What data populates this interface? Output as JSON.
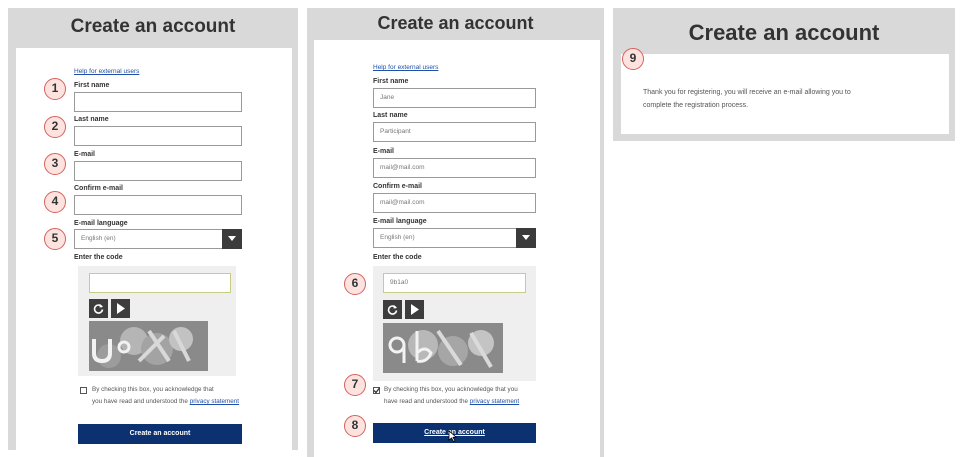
{
  "left": {
    "title": "Create an account",
    "help_link": "Help for external users",
    "first_name_label": "First name",
    "last_name_label": "Last name",
    "email_label": "E-mail",
    "confirm_email_label": "Confirm e-mail",
    "email_language_label": "E-mail language",
    "email_language_value": "English (en)",
    "code_label": "Enter the code",
    "code_value": "",
    "checkbox_text_1": "By checking this box, you acknowledge that",
    "checkbox_text_2": "you have read and understood the",
    "privacy_link": "privacy statement",
    "submit_label": "Create an account",
    "steps": [
      "1",
      "2",
      "3",
      "4",
      "5"
    ]
  },
  "middle": {
    "title": "Create an account",
    "help_link": "Help for external users",
    "first_name_label": "First name",
    "first_name_value": "Jane",
    "last_name_label": "Last name",
    "last_name_value": "Participant",
    "email_label": "E-mail",
    "email_value": "mail@mail.com",
    "confirm_email_label": "Confirm e-mail",
    "confirm_email_value": "mail@mail.com",
    "email_language_label": "E-mail language",
    "email_language_value": "English (en)",
    "code_label": "Enter the code",
    "code_value": "9b1a0",
    "checkbox_text_1": "By checking this box, you acknowledge that you",
    "checkbox_text_2": "have read and understood the",
    "privacy_link": "privacy statement",
    "submit_label": "Create an account",
    "steps": [
      "6",
      "7",
      "8"
    ]
  },
  "right": {
    "title": "Create an account",
    "message_1": "Thank you for registering, you will receive an e-mail allowing you to",
    "message_2": "complete the registration process.",
    "step": "9"
  },
  "colors": {
    "panel_bg": "#d9d9d9",
    "submit_bg": "#0c3170",
    "badge_border": "#d6615d",
    "badge_fill": "#fde3df",
    "link": "#1f4fa8"
  },
  "icons": [
    "chevron-down-icon",
    "refresh-icon",
    "play-icon"
  ]
}
